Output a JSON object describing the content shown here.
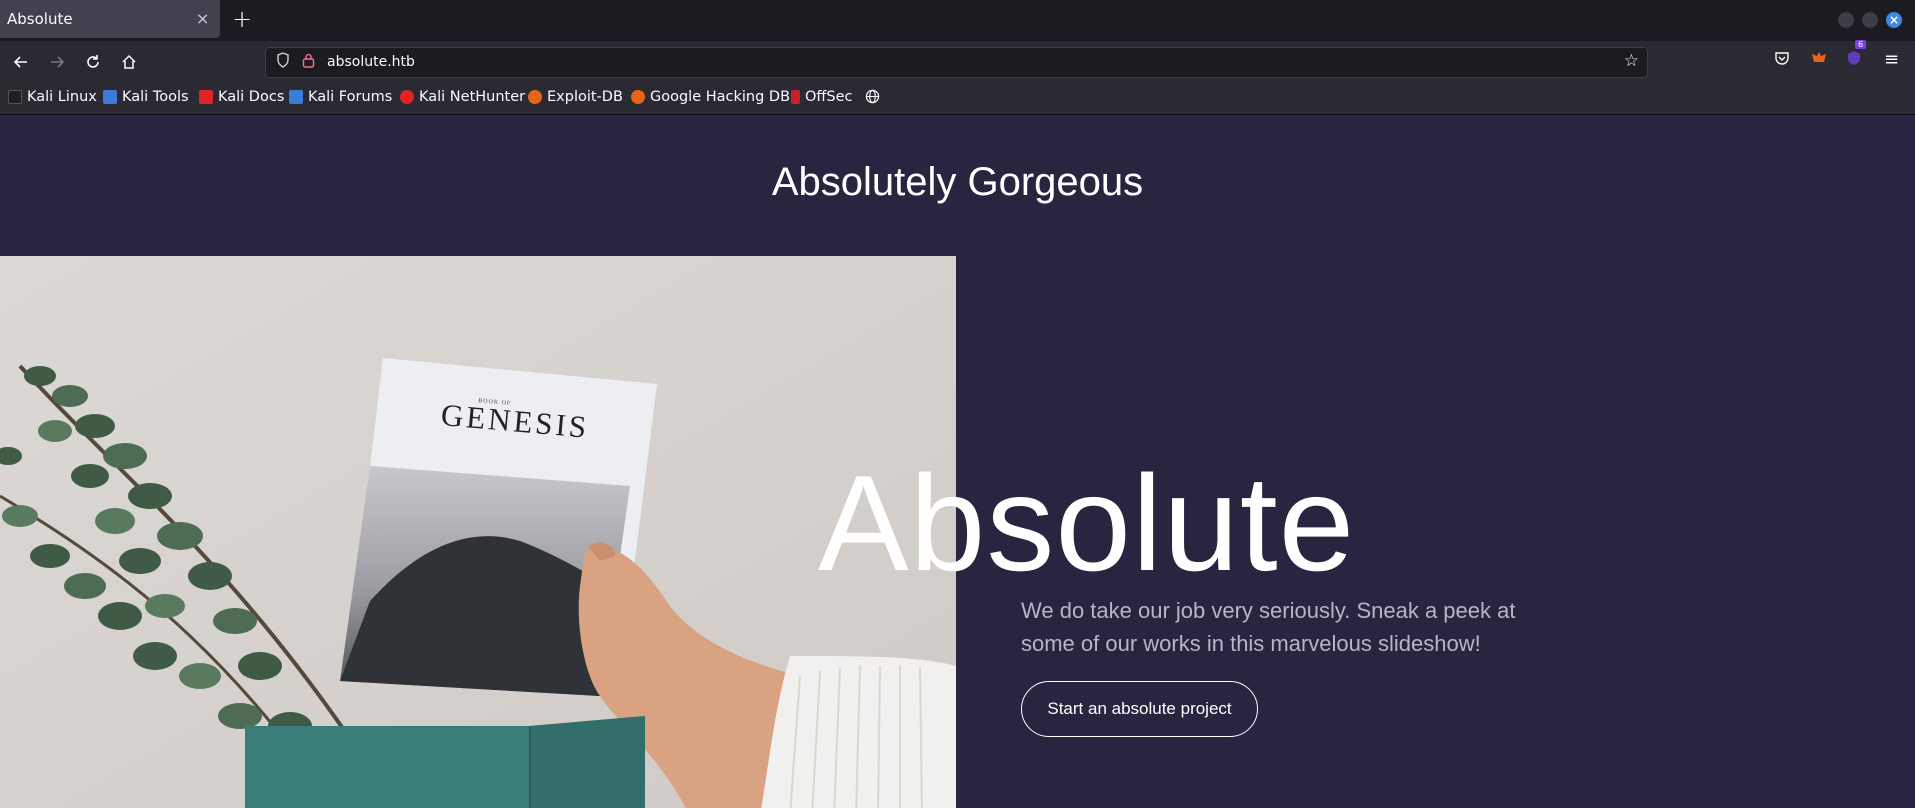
{
  "browser": {
    "tab_title": "Absolute",
    "tab_close": "×",
    "new_tab": "+",
    "url": "absolute.htb",
    "extension_badge": "6"
  },
  "bookmarks": [
    {
      "label": "Kali Linux",
      "color": "#1e1e1e"
    },
    {
      "label": "Kali Tools",
      "color": "#3d7bd9"
    },
    {
      "label": "Kali Docs",
      "color": "#e02424"
    },
    {
      "label": "Kali Forums",
      "color": "#3d7bd9"
    },
    {
      "label": "Kali NetHunter",
      "color": "#e02424"
    },
    {
      "label": "Exploit-DB",
      "color": "#e8641b"
    },
    {
      "label": "Google Hacking DB",
      "color": "#e8641b"
    },
    {
      "label": "OffSec",
      "color": "#c4232b"
    }
  ],
  "page": {
    "site_title": "Absolutely Gorgeous",
    "hero_heading": "Absolute",
    "hero_text": "We do take our job very seriously. Sneak a peek at some of our works in this marvelous slideshow!",
    "cta_label": "Start an absolute project",
    "book_title": "GENESIS",
    "book_subtitle": "BOOK OF"
  },
  "colors": {
    "page_bg": "#29243f",
    "accent_link": "#3f8ae0",
    "box_teal": "#3a7d78"
  }
}
